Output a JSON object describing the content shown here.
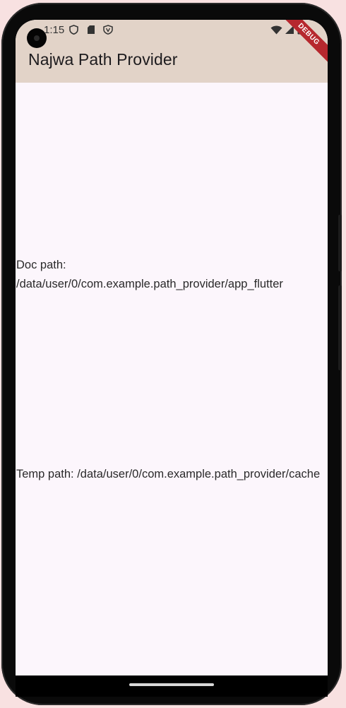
{
  "status_bar": {
    "time": "1:15",
    "icons": [
      "vpn-shield-icon",
      "sd-card-icon",
      "protect-icon",
      "wifi-icon",
      "cell-signal-icon",
      "battery-icon"
    ]
  },
  "app_bar": {
    "title": "Najwa Path Provider"
  },
  "debug_banner": {
    "label": "DEBUG",
    "color": "#b6282e"
  },
  "content": {
    "doc_path": "Doc path: /data/user/0/com.example.path_provider/app_flutter",
    "temp_path": "Temp path: /data/user/0/com.example.path_provider/cache"
  },
  "colors": {
    "app_bar": "#e2d3c8",
    "background": "#fcf6fc"
  }
}
